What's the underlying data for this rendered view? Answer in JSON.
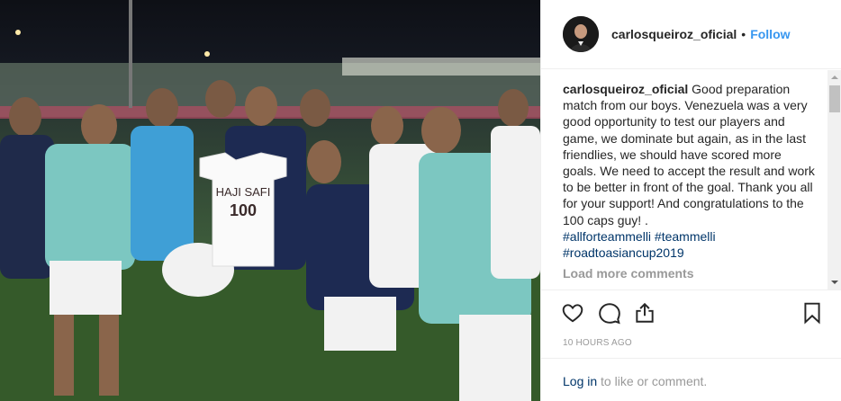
{
  "post": {
    "image_alt": "Iran national team players posing after a friendly match, one player holding a shirt printed HAJI SAFI 100",
    "shirt_name": "HAJI SAFI",
    "shirt_number": "100"
  },
  "header": {
    "username": "carlosqueiroz_oficial",
    "separator": "•",
    "follow_label": "Follow"
  },
  "caption": {
    "username": "carlosqueiroz_oficial",
    "text": "Good preparation match from our boys. Venezuela was a very good opportunity to test our players and game, we dominate but again, as in the last friendlies, we should have scored more goals. We need to accept the result and work to be better in front of the goal. Thank you all for your support! And congratulations to the 100 caps guy! .",
    "hashtags_line1": "#allforteammelli #teammelli",
    "hashtags_line2": "#roadtoasiancup2019"
  },
  "comments": {
    "load_more_label": "Load more comments"
  },
  "actions": {
    "icons": [
      "heart-icon",
      "comment-icon",
      "share-icon",
      "bookmark-icon"
    ]
  },
  "timestamp": "10 HOURS AGO",
  "footer": {
    "login_label": "Log in",
    "login_suffix": " to like or comment."
  },
  "colors": {
    "link": "#3897f0",
    "hashtag": "#003569",
    "muted": "#999999"
  }
}
